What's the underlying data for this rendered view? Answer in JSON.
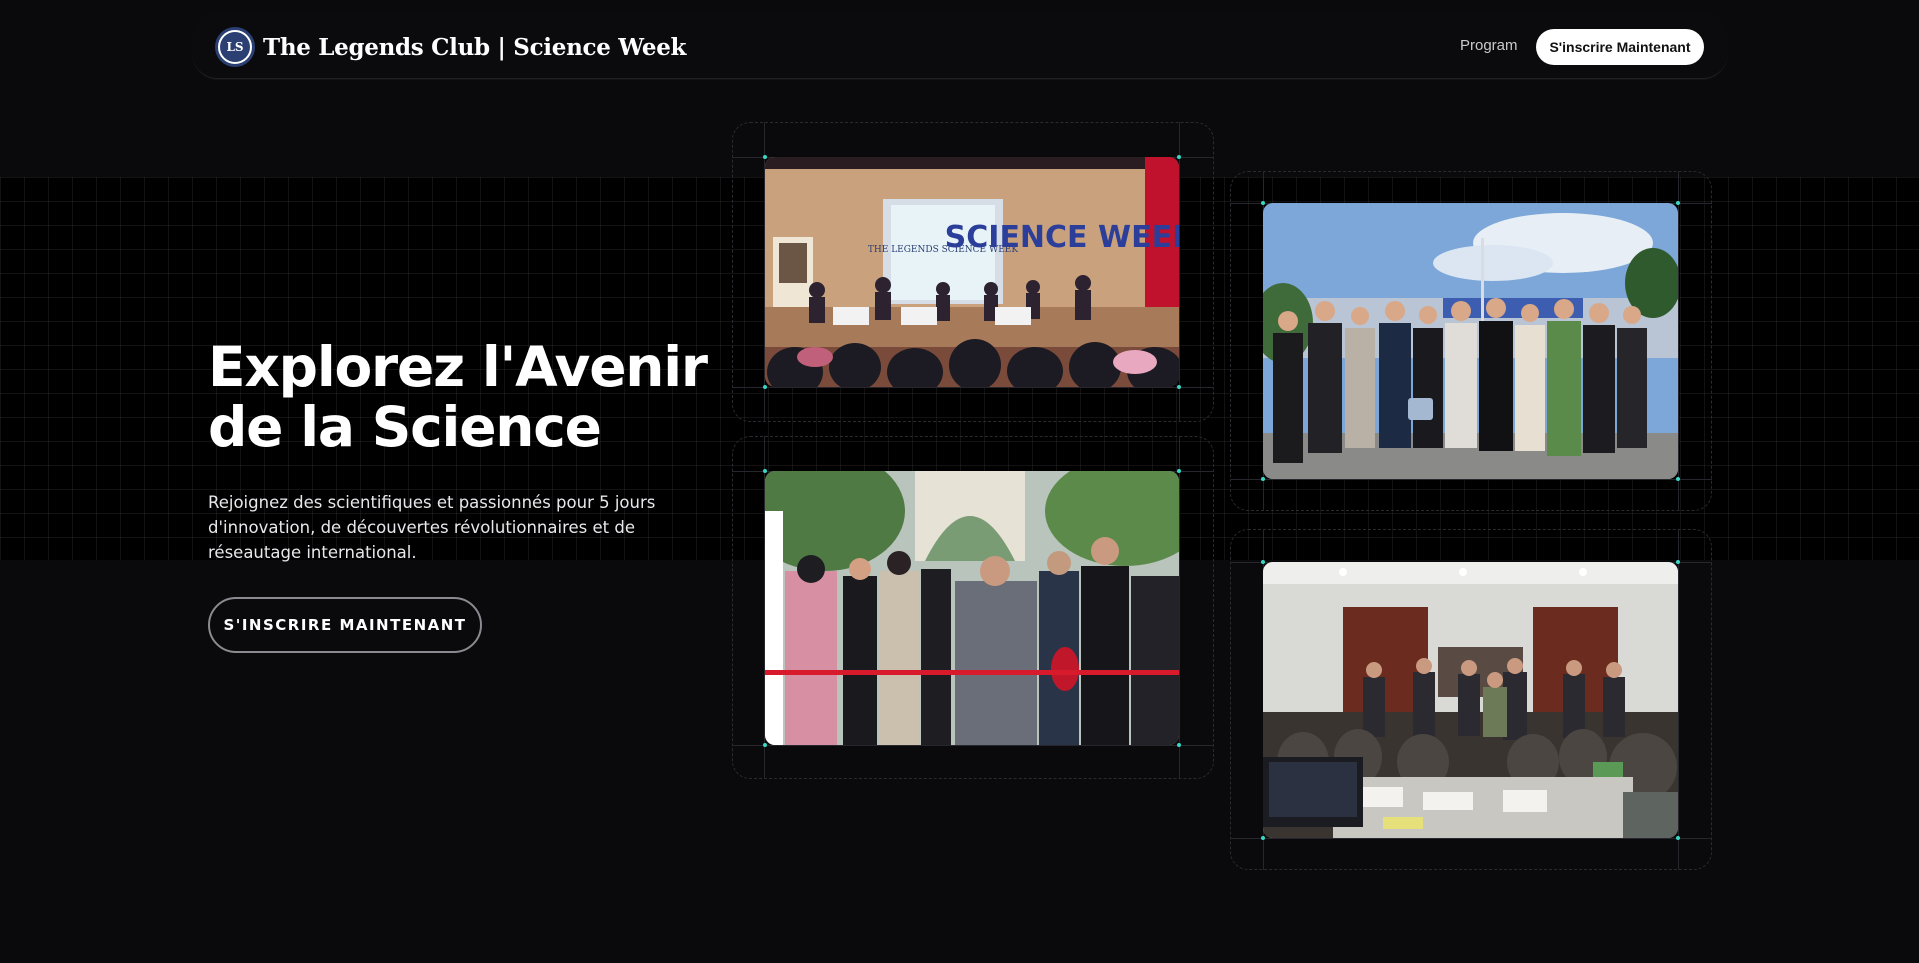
{
  "header": {
    "logo_text": "LS",
    "brand_title": "The Legends Club | Science Week",
    "nav_link": "Program",
    "cta_label": "S'inscrire Maintenant"
  },
  "hero": {
    "title": "Explorez l'Avenir de la Science",
    "description": "Rejoignez des scientifiques et passionnés pour 5 jours d'innovation, de découvertes révolutionnaires et de réseautage international.",
    "cta_label": "S'INSCRIRE MAINTENANT"
  },
  "gallery": {
    "photo1": {
      "icon": "conference-panel-photo",
      "banner_text": "SCIENCE WEEK",
      "screen_text": "THE LEGENDS SCIENCE WEEK"
    },
    "photo2": {
      "icon": "group-photo-outdoor"
    },
    "photo3": {
      "icon": "ribbon-cutting-photo"
    },
    "photo4": {
      "icon": "meeting-room-group-photo"
    }
  },
  "colors": {
    "background": "#0a0a0c",
    "accent_dot": "#3ad6c4",
    "logo_blue": "#2b3f73"
  }
}
